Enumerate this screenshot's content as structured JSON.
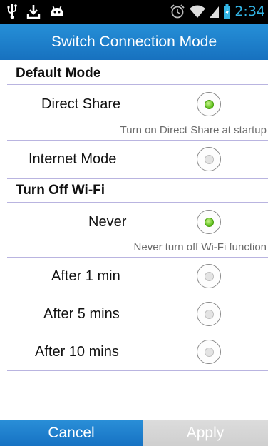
{
  "status_bar": {
    "icons_left": [
      "usb-icon",
      "download-icon",
      "android-icon"
    ],
    "icons_right": [
      "alarm-icon",
      "wifi-icon",
      "signal-icon",
      "battery-icon"
    ],
    "time": "2:34"
  },
  "header": {
    "title": "Switch Connection Mode"
  },
  "default_mode": {
    "title": "Default Mode",
    "options": [
      {
        "label": "Direct Share",
        "checked": true,
        "hint": "Turn on Direct Share at startup"
      },
      {
        "label": "Internet Mode",
        "checked": false
      }
    ]
  },
  "wifi": {
    "title": "Turn Off Wi-Fi",
    "options": [
      {
        "label": "Never",
        "checked": true,
        "hint": "Never turn off Wi-Fi function"
      },
      {
        "label": "After 1 min",
        "checked": false
      },
      {
        "label": "After 5 mins",
        "checked": false
      },
      {
        "label": "After 10 mins",
        "checked": false
      }
    ]
  },
  "footer": {
    "cancel_label": "Cancel",
    "apply_label": "Apply"
  },
  "colors": {
    "accent": "#1b7cc9",
    "radio_checked": "#5bbf18",
    "divider": "#b9b4e0",
    "time": "#33b5e5"
  }
}
